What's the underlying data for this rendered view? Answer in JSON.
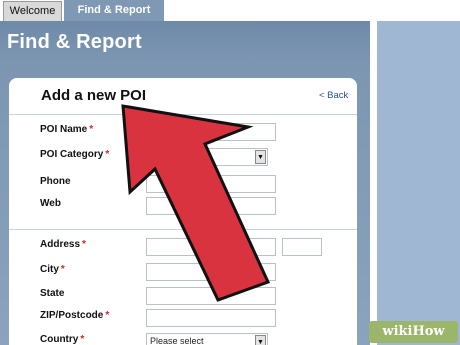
{
  "tabs": [
    {
      "label": "Welcome"
    },
    {
      "label": "Find & Report"
    }
  ],
  "page": {
    "title": "Find & Report"
  },
  "form": {
    "title": "Add a new POI",
    "back_label": "< Back",
    "required_marker": "*",
    "fields": [
      {
        "label": "POI Name",
        "required": true
      },
      {
        "label": "POI Category",
        "required": true
      },
      {
        "label": "Phone",
        "required": false
      },
      {
        "label": "Web",
        "required": false
      },
      {
        "label": "Address",
        "required": true
      },
      {
        "label": "City",
        "required": true
      },
      {
        "label": "State",
        "required": false
      },
      {
        "label": "ZIP/Postcode",
        "required": true
      },
      {
        "label": "Country",
        "required": true
      }
    ],
    "country_select_value": "Please select"
  },
  "overlay": {
    "arrow_color": "#d8333f",
    "arrow_outline": "#111111"
  },
  "watermark": {
    "wiki": "wiki",
    "how": "How"
  }
}
